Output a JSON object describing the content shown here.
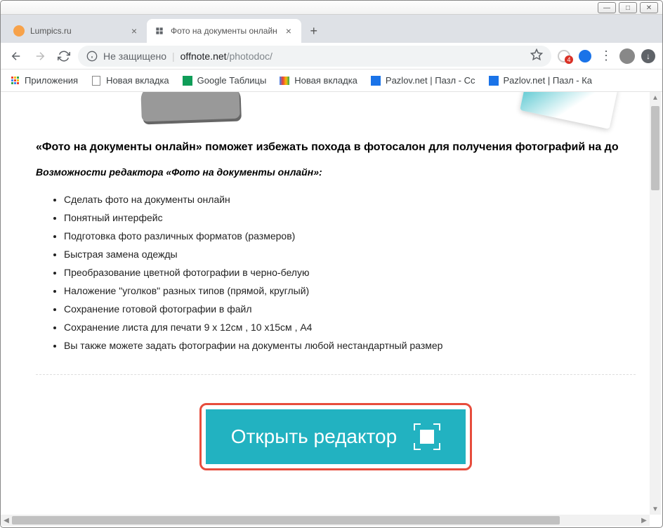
{
  "tabs": [
    {
      "title": "Lumpics.ru",
      "favicon_color": "#f7a24a"
    },
    {
      "title": "Фото на документы онлайн",
      "favicon_color": "#5f6368"
    }
  ],
  "omnibox": {
    "security_label": "Не защищено",
    "host": "offnote.net",
    "path": "/photodoc/"
  },
  "bookmarks": {
    "apps": "Приложения",
    "items": [
      "Новая вкладка",
      "Google Таблицы",
      "Новая вкладка",
      "Pazlov.net | Пазл - Сс",
      "Pazlov.net | Пазл - Ка"
    ]
  },
  "page": {
    "headline": "«Фото на документы онлайн» поможет избежать похода в фотосалон для получения фотографий на до",
    "subhead": "Возможности редактора «Фото на документы онлайн»:",
    "features": [
      "Сделать фото на документы онлайн",
      "Понятный интерфейс",
      "Подготовка фото различных форматов (размеров)",
      "Быстрая замена одежды",
      "Преобразование цветной фотографии в черно-белую",
      "Наложение \"уголков\" разных типов (прямой, круглый)",
      "Сохранение готовой фотографии в файл",
      "Сохранение листа для печати 9 х 12см , 10 х15см , А4",
      "Вы также можете задать фотографии на документы любой нестандартный размер"
    ],
    "cta_label": "Открыть редактор"
  }
}
